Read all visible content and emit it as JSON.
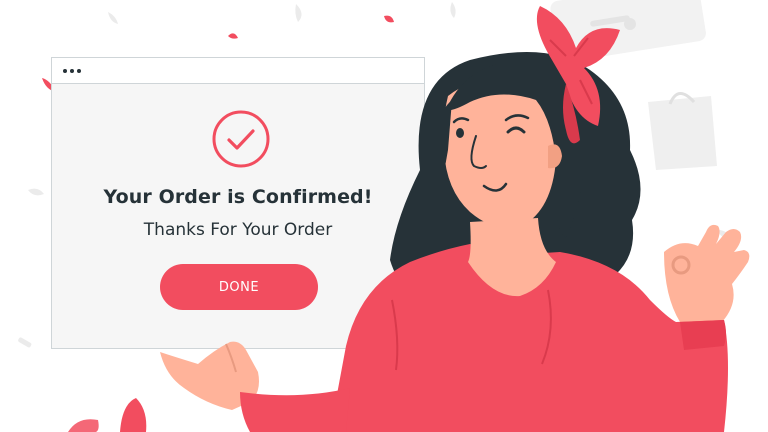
{
  "window": {
    "title": "Your Order is Confirmed!",
    "subtitle": "Thanks For Your Order",
    "button_label": "DONE"
  },
  "colors": {
    "accent": "#f24d5f",
    "dark": "#263238",
    "skin": "#ffb39a",
    "window_bg": "#f6f6f6"
  },
  "icons": [
    "window-dots-icon",
    "checkmark-circle-icon",
    "shopping-bag-icon",
    "credit-card-icon"
  ]
}
